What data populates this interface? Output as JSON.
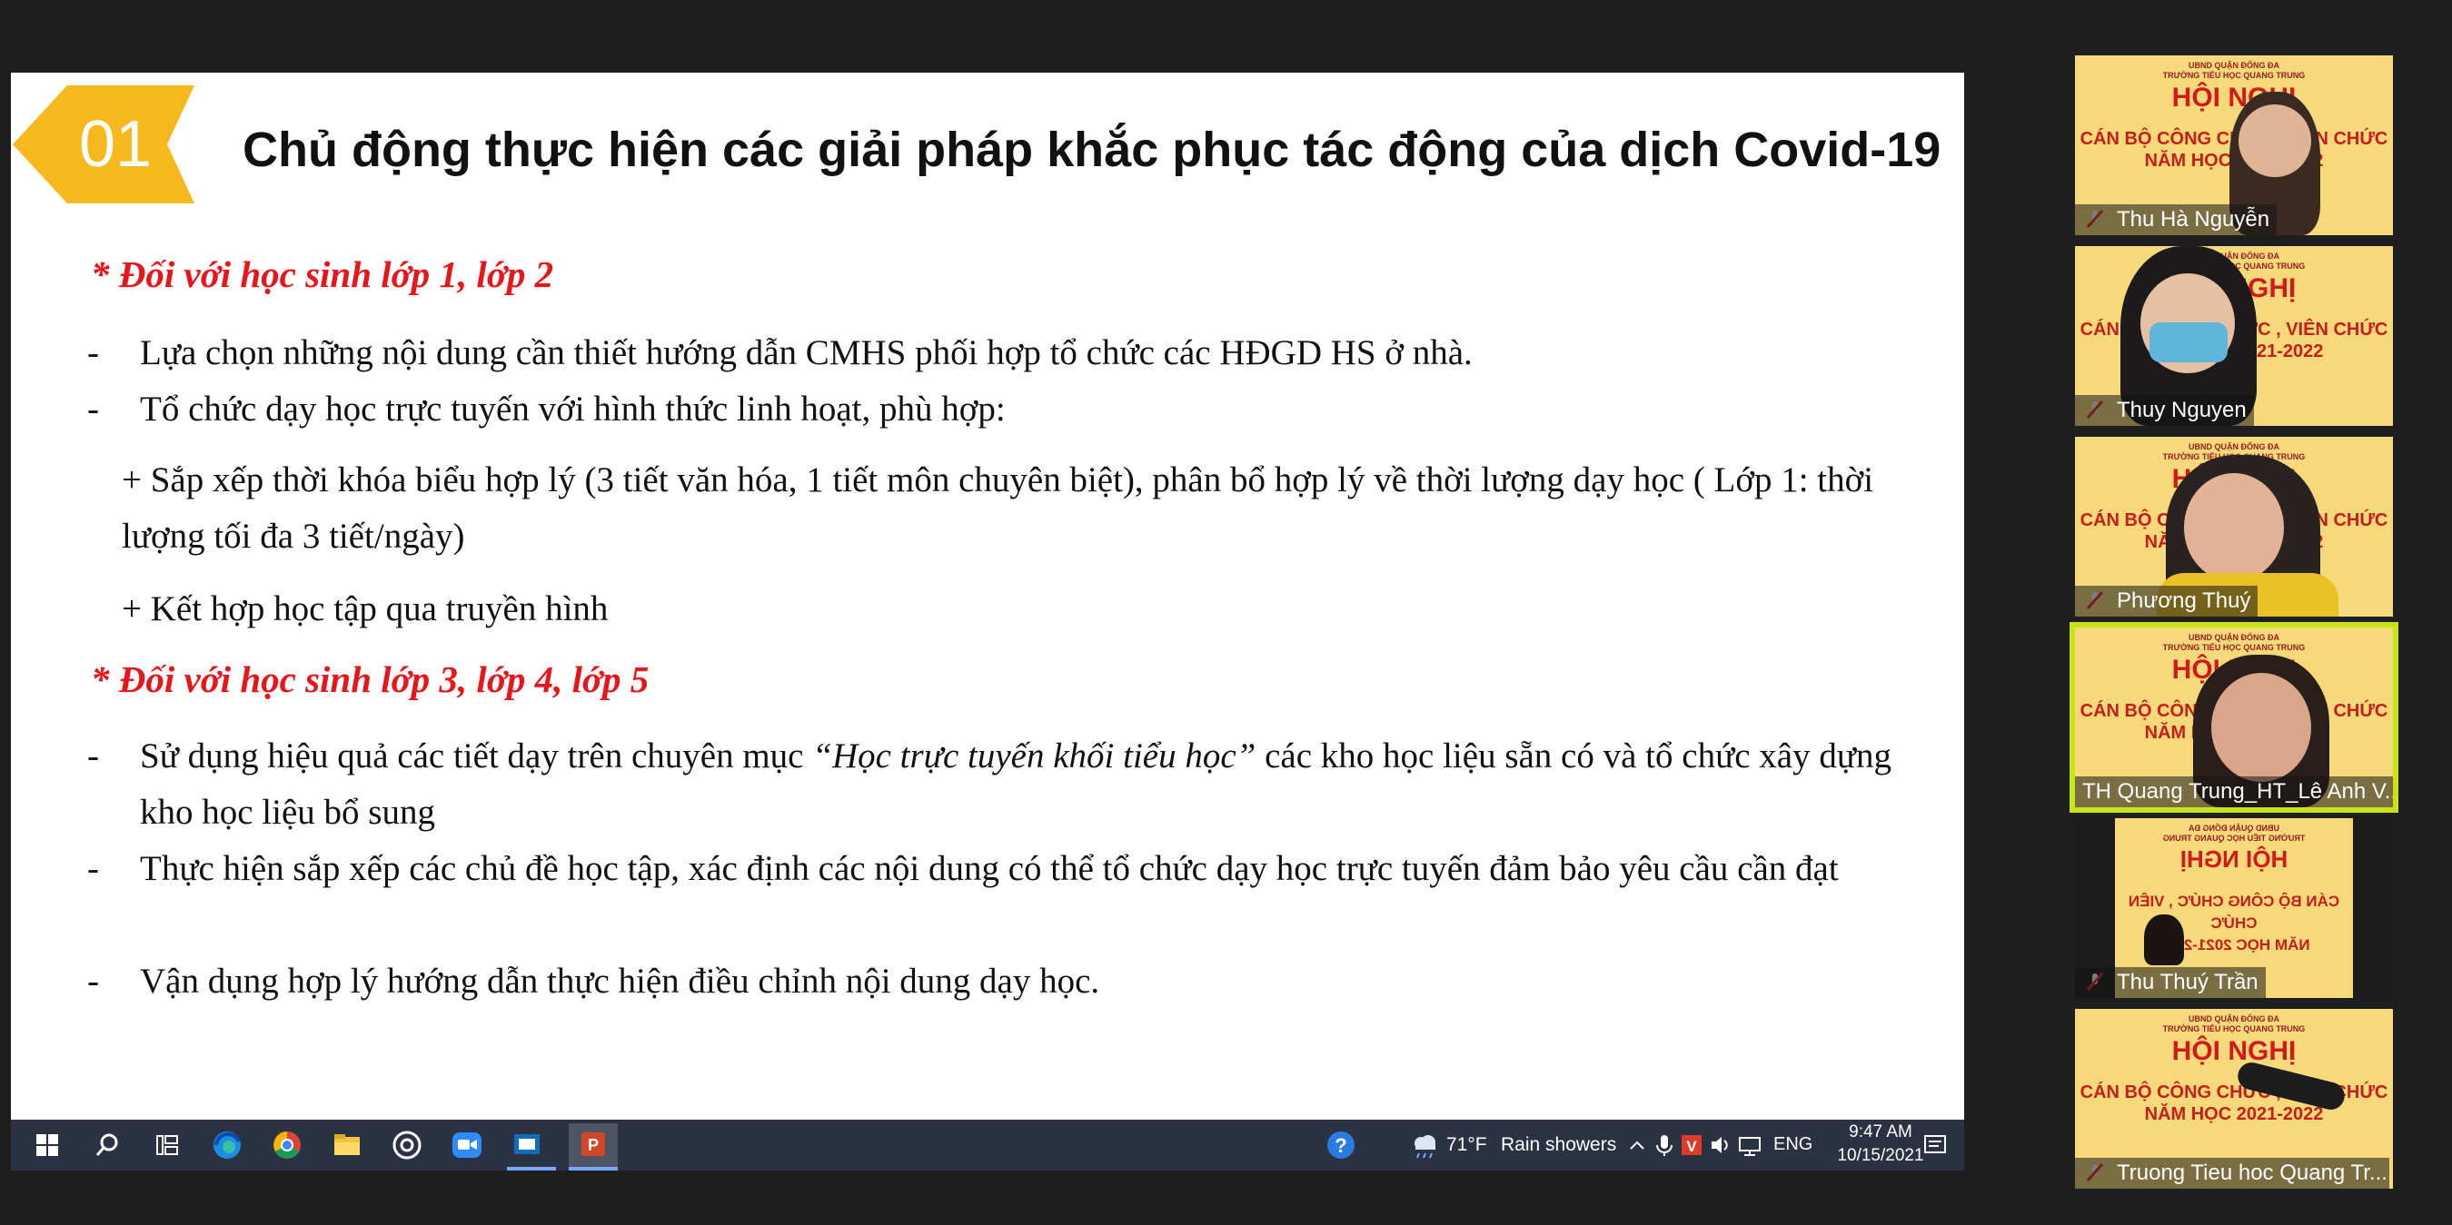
{
  "slide": {
    "badge_number": "01",
    "title": "Chủ động thực hiện các giải pháp khắc phục tác động của dịch Covid-19",
    "section1_heading": "* Đối với học sinh lớp 1, lớp 2",
    "section1_bullets": [
      "Lựa chọn những nội dung cần thiết hướng dẫn CMHS phối hợp tổ chức các HĐGD HS ở nhà.",
      "Tổ chức dạy học trực tuyến với hình thức linh hoạt, phù hợp:"
    ],
    "plus1": "+ Sắp xếp thời khóa biểu hợp lý (3 tiết văn hóa, 1 tiết môn chuyên biệt), phân bổ hợp lý về thời lượng dạy học ( Lớp 1: thời lượng tối đa 3 tiết/ngày)",
    "plus2": "+ Kết hợp học tập qua truyền hình",
    "section2_heading": "* Đối với học sinh lớp 3, lớp 4, lớp 5",
    "section2_bullet1_pre": "Sử dụng hiệu quả các tiết dạy trên chuyên mục ",
    "section2_bullet1_italic": "“Học trực tuyến khối tiểu học”",
    "section2_bullet1_post": " các kho học liệu sẵn có và tổ chức xây dựng kho học liệu bổ sung",
    "section2_bullet2": "Thực hiện sắp xếp các chủ đề học tập, xác định các nội dung có thể tổ chức dạy học trực tuyến đảm bảo yêu cầu cần đạt",
    "section2_bullet3": "Vận dụng hợp lý hướng dẫn thực hiện điều chỉnh nội dung dạy học.",
    "dash": "-"
  },
  "taskbar": {
    "weather_temp": "71°F",
    "weather_text": "Rain showers",
    "language": "ENG",
    "time": "9:47 AM",
    "date": "10/15/2021"
  },
  "banner": {
    "small_line1": "UBND QUẬN ĐỐNG ĐA",
    "small_line2": "TRƯỜNG TIỂU HỌC QUANG TRUNG",
    "big": "HỘI NGHỊ",
    "mid_line1": "CÁN BỘ CÔNG CHỨC , VIÊN CHỨC",
    "mid_line2": "NĂM HỌC 2021-2022"
  },
  "participants": [
    {
      "name": "Thu Hà Nguyễn"
    },
    {
      "name": "Thuy Nguyen"
    },
    {
      "name": "Phương Thuý"
    },
    {
      "name": "TH Quang Trung_HT_Lê Anh V..."
    },
    {
      "name": "Thu Thuý Trần"
    },
    {
      "name": "Truong Tieu hoc Quang Tr..."
    }
  ],
  "colors": {
    "badge": "#f6b81c",
    "heading_red": "#e8161a",
    "active_speaker": "#c8e31a",
    "taskbar": "#2b3243"
  }
}
